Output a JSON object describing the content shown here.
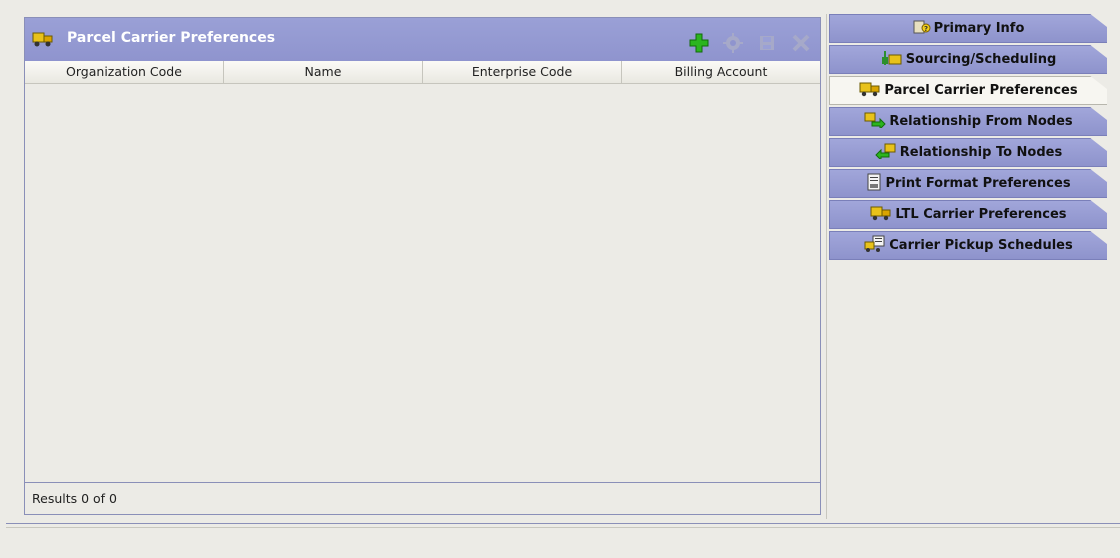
{
  "panel": {
    "title": "Parcel Carrier Preferences",
    "icons": {
      "header": "truck-icon"
    },
    "toolbar": [
      {
        "name": "add-button",
        "icon": "plus-icon",
        "enabled": true,
        "color": "#2bb51e"
      },
      {
        "name": "details-button",
        "icon": "gear-icon",
        "enabled": false
      },
      {
        "name": "save-button",
        "icon": "save-icon",
        "enabled": false
      },
      {
        "name": "delete-button",
        "icon": "close-icon",
        "enabled": false
      }
    ],
    "columns": [
      "Organization Code",
      "Name",
      "Enterprise Code",
      "Billing Account"
    ],
    "status": "Results 0 of 0"
  },
  "tabs": [
    {
      "label": "Primary Info",
      "icon": "info-icon",
      "active": false
    },
    {
      "label": "Sourcing/Scheduling",
      "icon": "scheduling-icon",
      "active": false
    },
    {
      "label": "Parcel Carrier Preferences",
      "icon": "truck-icon",
      "active": true
    },
    {
      "label": "Relationship From Nodes",
      "icon": "relationship-from-icon",
      "active": false
    },
    {
      "label": "Relationship To Nodes",
      "icon": "relationship-to-icon",
      "active": false
    },
    {
      "label": "Print Format Preferences",
      "icon": "print-format-icon",
      "active": false
    },
    {
      "label": "LTL Carrier Preferences",
      "icon": "truck-icon",
      "active": false
    },
    {
      "label": "Carrier Pickup Schedules",
      "icon": "pickup-schedule-icon",
      "active": false
    }
  ],
  "colors": {
    "header": "#9096cf",
    "tab": "#9aa0d6",
    "active_tab": "#f7f6f1"
  }
}
